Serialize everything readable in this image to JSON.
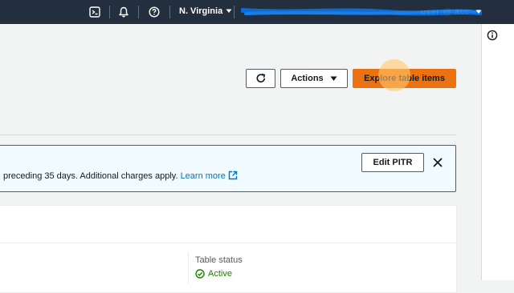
{
  "topbar": {
    "cloudshell_icon": "cloudshell-terminal-icon",
    "notifications_icon": "bell-icon",
    "help_icon": "help-circle-icon",
    "region_label": "N. Virginia",
    "account_label": "user @ acc",
    "account_redacted": true,
    "redaction_color": "#0a6cd6"
  },
  "right_rail": {
    "info_icon": "info-circle-icon"
  },
  "header": {
    "refresh_icon": "refresh-icon",
    "actions_label": "Actions",
    "explore_label": "Explore table items",
    "primary_color": "#ec7211"
  },
  "alert": {
    "text": "preceding 35 days. Additional charges apply.",
    "link_label": "Learn more",
    "edit_button_label": "Edit PITR",
    "close_icon": "close-icon"
  },
  "details": {
    "table_status_label": "Table status",
    "table_status_value": "Active",
    "status_color": "#1d8102"
  }
}
